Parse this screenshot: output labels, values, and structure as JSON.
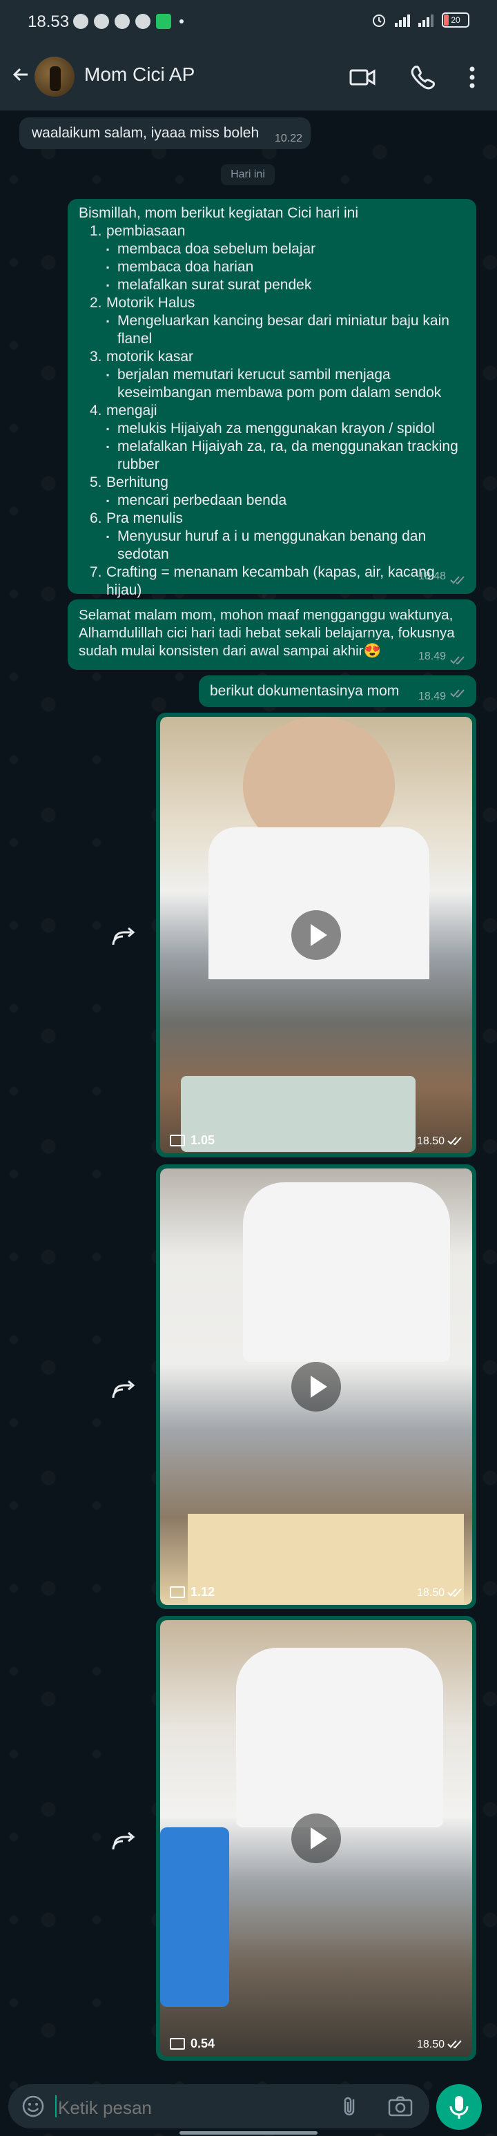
{
  "status_bar": {
    "time": "18.53",
    "battery": "20"
  },
  "header": {
    "contact_name": "Mom Cici AP"
  },
  "messages": {
    "first_in": {
      "text": "waalaikum salam, iyaaa miss boleh",
      "time": "10.22"
    },
    "date_chip": "Hari ini",
    "plan": {
      "intro": "Bismillah, mom berikut kegiatan Cici hari ini",
      "items": [
        {
          "n": "1",
          "text": "pembiasaan"
        },
        {
          "sub": "membaca doa sebelum belajar"
        },
        {
          "sub": "membaca doa harian"
        },
        {
          "sub": "melafalkan surat surat pendek"
        },
        {
          "n": "2",
          "text": "Motorik Halus"
        },
        {
          "sub": "Mengeluarkan kancing besar dari miniatur baju kain flanel"
        },
        {
          "n": "3",
          "text": "motorik kasar"
        },
        {
          "sub": "berjalan memutari kerucut sambil menjaga keseimbangan membawa pom pom dalam sendok"
        },
        {
          "n": "4",
          "text": "mengaji"
        },
        {
          "sub": "melukis Hijaiyah za menggunakan krayon / spidol"
        },
        {
          "sub": "melafalkan Hijaiyah za, ra, da menggunakan tracking rubber"
        },
        {
          "n": "5",
          "text": "Berhitung"
        },
        {
          "sub": "mencari perbedaan benda"
        },
        {
          "n": "6",
          "text": "Pra menulis"
        },
        {
          "sub": "Menyusur huruf a i u menggunakan benang dan sedotan"
        },
        {
          "n": "7",
          "text": "Crafting = menanam kecambah (kapas, air, kacang hijau)"
        }
      ],
      "time": "18.48"
    },
    "greeting": {
      "text": "Selamat malam mom, mohon maaf mengganggu waktunya, Alhamdulillah cici hari tadi hebat sekali belajarnya, fokusnya sudah mulai konsisten dari awal sampai akhir",
      "emoji": "😍",
      "time": "18.49"
    },
    "doc_intro": {
      "text": "berikut dokumentasinya mom",
      "time": "18.49"
    },
    "videos": [
      {
        "duration": "1.05",
        "time": "18.50"
      },
      {
        "duration": "1.12",
        "time": "18.50"
      },
      {
        "duration": "0.54",
        "time": "18.50"
      }
    ]
  },
  "input": {
    "placeholder": "Ketik pesan"
  },
  "colors": {
    "out_bubble": "#005c4b",
    "in_bubble": "#202c33",
    "accent": "#00a884"
  }
}
